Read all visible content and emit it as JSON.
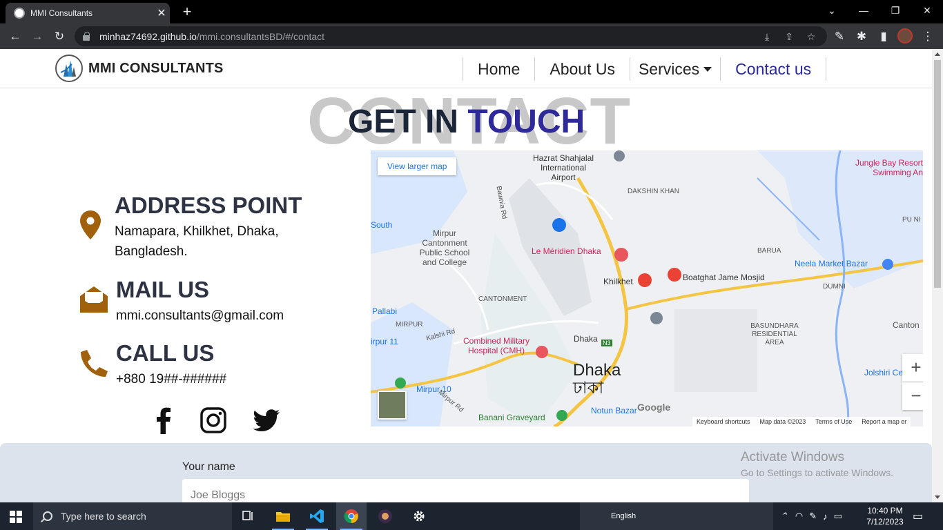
{
  "browser": {
    "tab_title": "MMI Consultants",
    "url_host": "minhaz74692.github.io",
    "url_path": "/mmi.consultantsBD/#/contact"
  },
  "site": {
    "brand": "MMI CONSULTANTS",
    "nav": [
      {
        "label": "Home"
      },
      {
        "label": "About Us"
      },
      {
        "label": "Services"
      },
      {
        "label": "Contact us"
      }
    ],
    "bg_word": "CONTACT",
    "heading_main": "GET IN",
    "heading_accent": "TOUCH",
    "address": {
      "title": "ADDRESS POINT",
      "line1": "Namapara, Khilkhet, Dhaka,",
      "line2": "Bangladesh."
    },
    "mail": {
      "title": "MAIL US",
      "value": "mmi.consultants@gmail.com"
    },
    "call": {
      "title": "CALL US",
      "value": "+880 19##-######"
    },
    "accent_color": "#a0600c"
  },
  "map": {
    "view_larger": "View larger map",
    "city_en": "Dhaka",
    "city_bn": "ঢাকা",
    "labels": [
      "Hazrat Shahjalal International Airport",
      "Le Méridien Dhaka",
      "Khilkhet",
      "Boatghat Jame Mosjid",
      "Neela Market Bazar",
      "Jungle Bay Resort Swimming An",
      "DAKSHIN KHAN",
      "BARUA",
      "DUMNI",
      "CANTONMENT",
      "Mirpur Cantonment Public School and College",
      "MIRPUR",
      "Pallabi",
      "South",
      "irpur 11",
      "Kalshi Rd",
      "Bawnia Rd",
      "Combined Military Hospital (CMH)",
      "BASUNDHARA RESIDENTIAL AREA",
      "Dhaka",
      "N3",
      "Mirpur 10",
      "Mirpur Rd",
      "Banani Graveyard",
      "Notun Bazar",
      "Jolshiri Cer",
      "Canton",
      "PU NI"
    ],
    "footer": [
      "Keyboard shortcuts",
      "Map data ©2023",
      "Terms of Use",
      "Report a map er"
    ],
    "zoom_in": "+",
    "zoom_out": "−",
    "google": "Google"
  },
  "form": {
    "name_label": "Your name",
    "name_placeholder": "Joe Bloggs"
  },
  "watermark": {
    "line1": "Activate Windows",
    "line2": "Go to Settings to activate Windows."
  },
  "taskbar": {
    "search_placeholder": "Type here to search",
    "language": "English",
    "time": "10:40 PM",
    "date": "7/12/2023"
  }
}
